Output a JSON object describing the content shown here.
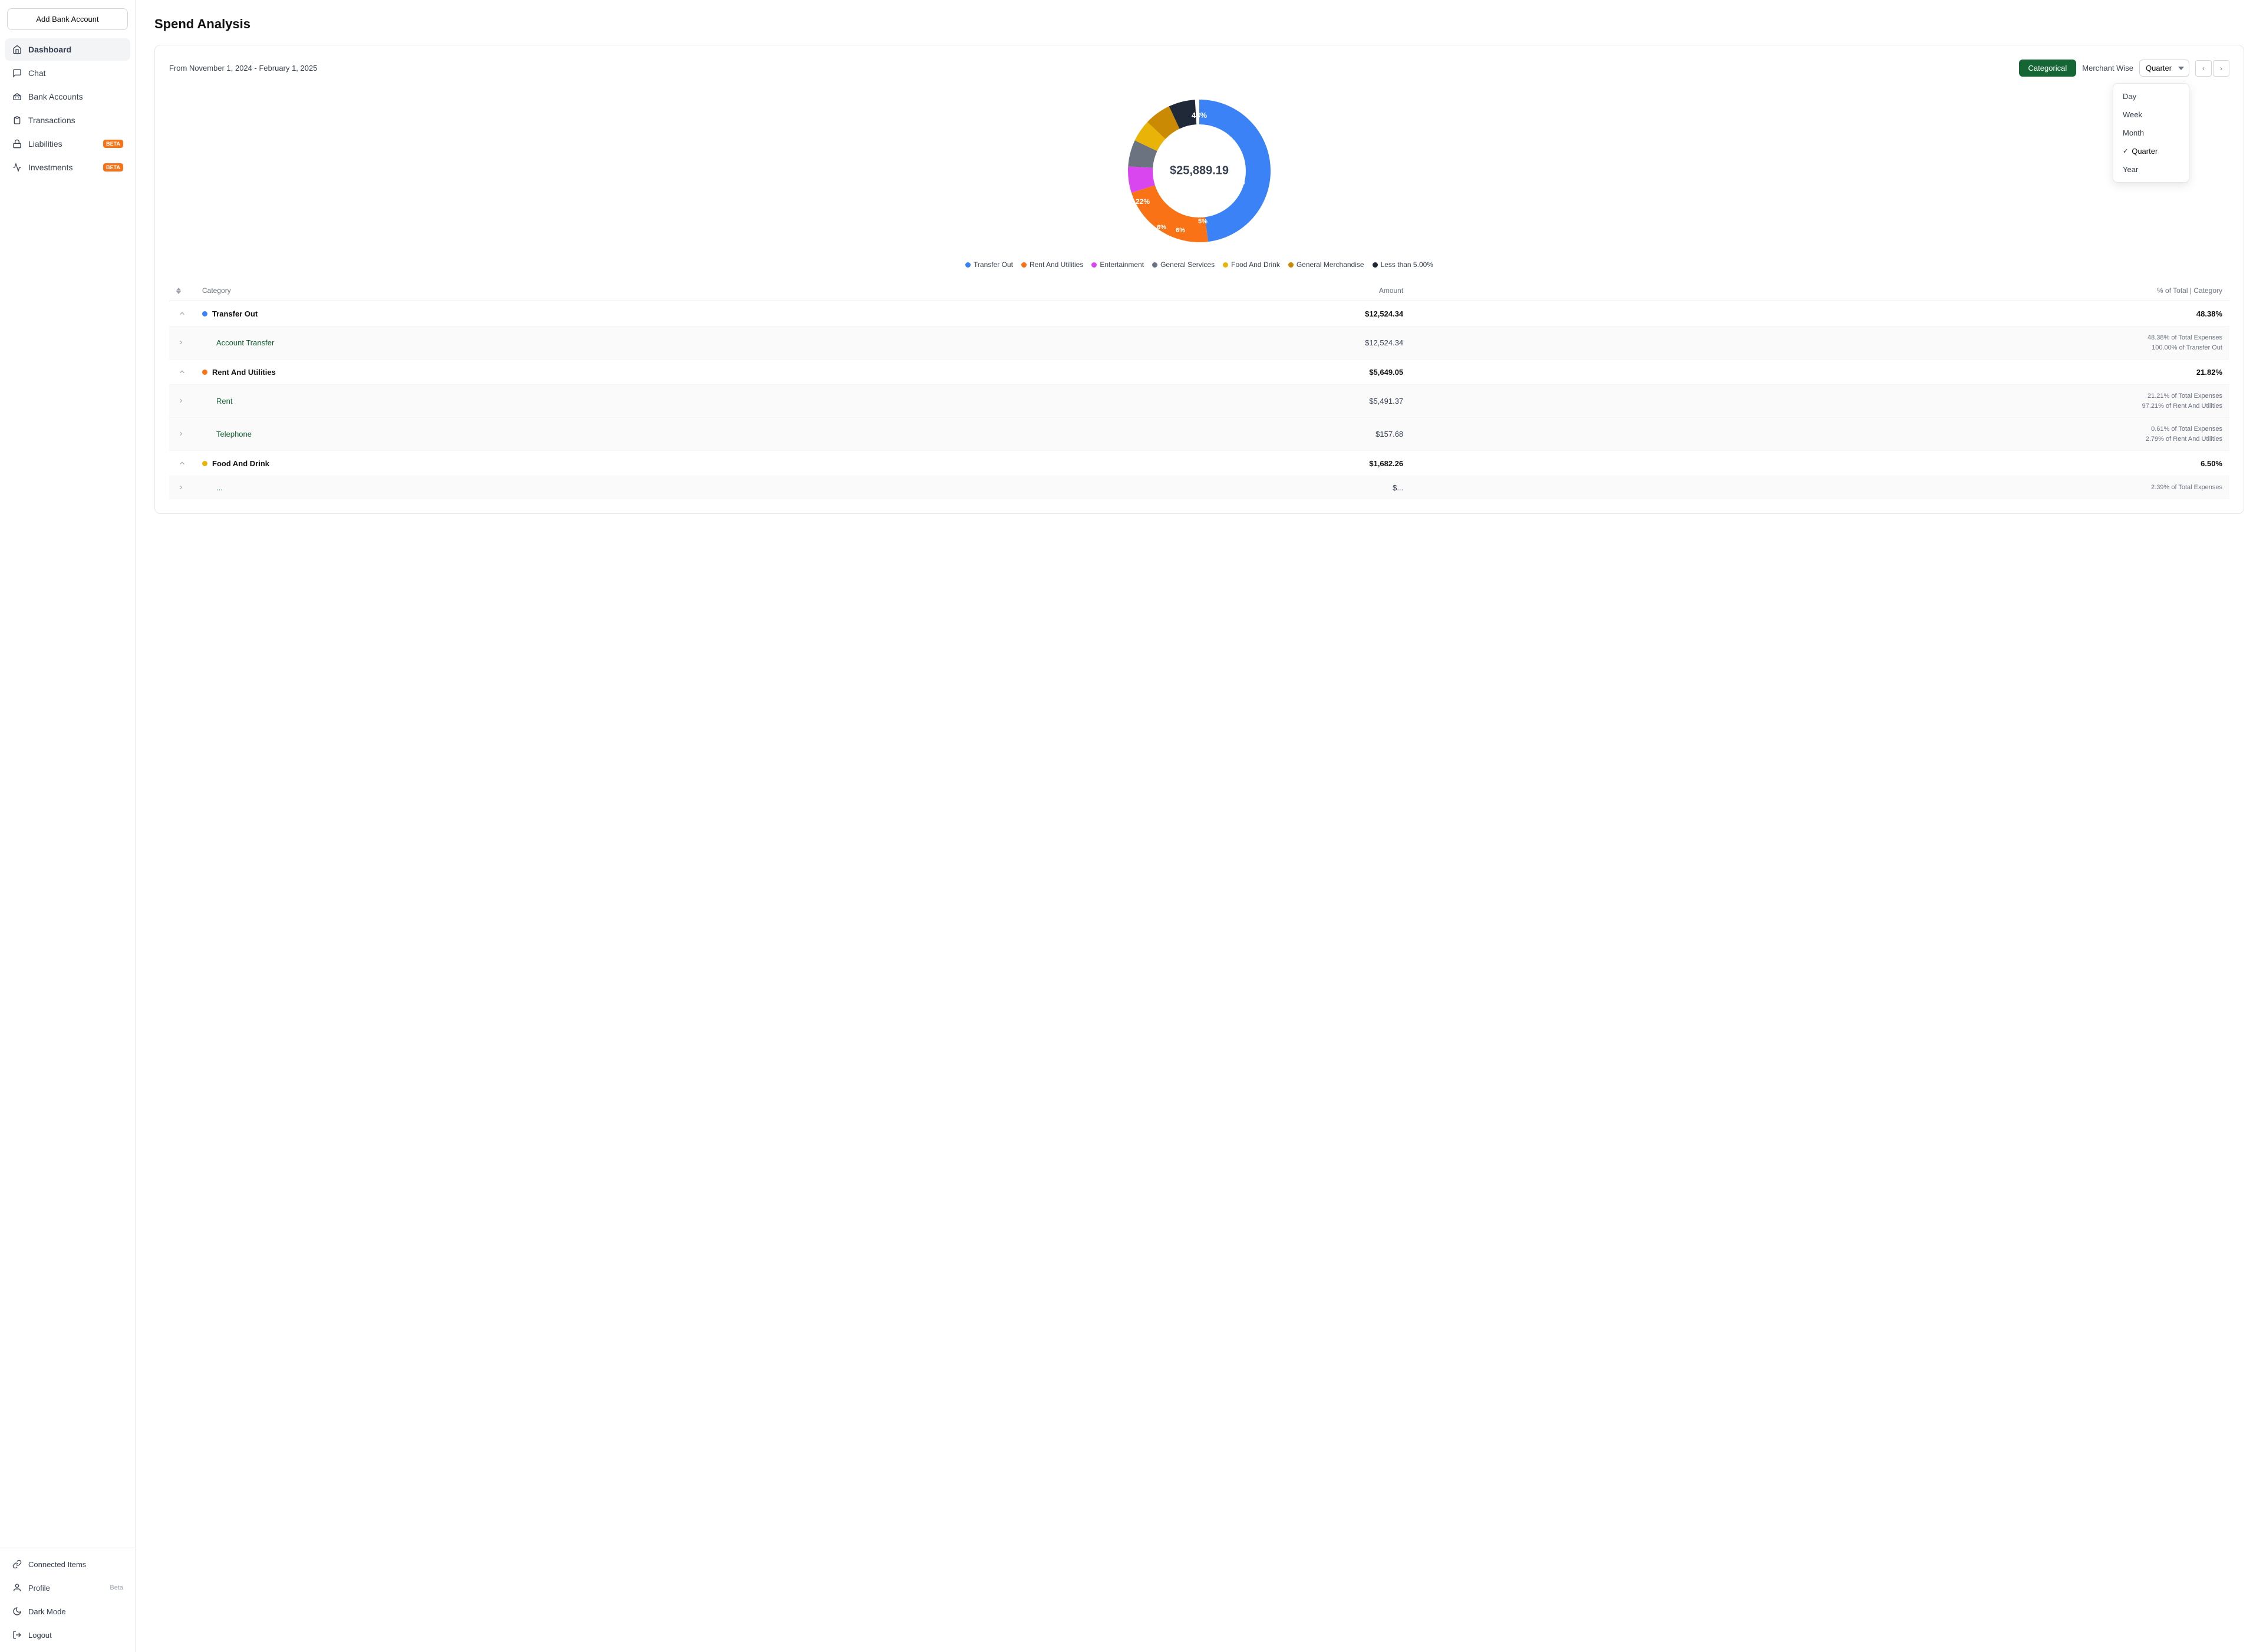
{
  "sidebar": {
    "add_bank_label": "Add Bank Account",
    "nav_items": [
      {
        "id": "dashboard",
        "label": "Dashboard",
        "icon": "house",
        "active": true,
        "badge": null
      },
      {
        "id": "chat",
        "label": "Chat",
        "icon": "chat",
        "active": false,
        "badge": null
      },
      {
        "id": "bank-accounts",
        "label": "Bank Accounts",
        "icon": "bank",
        "active": false,
        "badge": null
      },
      {
        "id": "transactions",
        "label": "Transactions",
        "icon": "receipt",
        "active": false,
        "badge": null
      },
      {
        "id": "liabilities",
        "label": "Liabilities",
        "icon": "lock",
        "active": false,
        "badge": "BETA"
      },
      {
        "id": "investments",
        "label": "Investments",
        "icon": "chart",
        "active": false,
        "badge": "BETA"
      }
    ],
    "bottom_items": [
      {
        "id": "connected-items",
        "label": "Connected Items",
        "icon": "link"
      },
      {
        "id": "profile",
        "label": "Profile",
        "icon": "person",
        "badge_text": "Beta"
      },
      {
        "id": "dark-mode",
        "label": "Dark Mode",
        "icon": "moon"
      },
      {
        "id": "logout",
        "label": "Logout",
        "icon": "door"
      }
    ]
  },
  "main": {
    "page_title": "Spend Analysis",
    "date_range": "From November 1, 2024 - February 1, 2025",
    "view_buttons": {
      "categorical": "Categorical",
      "merchant_wise": "Merchant Wise"
    },
    "time_selector": {
      "current": "Quarter",
      "options": [
        "Day",
        "Week",
        "Month",
        "Quarter",
        "Year"
      ]
    },
    "chart": {
      "center_value": "$25,889.19",
      "segments": [
        {
          "label": "Transfer Out",
          "color": "#3b82f6",
          "pct": 48,
          "start_angle": 0
        },
        {
          "label": "Rent And Utilities",
          "color": "#f97316",
          "pct": 22,
          "start_angle": 173
        },
        {
          "label": "Entertainment",
          "color": "#d946ef",
          "pct": 6,
          "start_angle": 252
        },
        {
          "label": "General Services",
          "color": "#6b7280",
          "pct": 6,
          "start_angle": 274
        },
        {
          "label": "Food And Drink",
          "color": "#eab308",
          "pct": 5,
          "start_angle": 296
        },
        {
          "label": "General Merchandise",
          "color": "#ca8a04",
          "pct": 6,
          "start_angle": 314
        },
        {
          "label": "Less than 5.00%",
          "color": "#1f2937",
          "pct": 6,
          "start_angle": 336
        }
      ]
    },
    "legend": [
      {
        "label": "Transfer Out",
        "color": "#3b82f6"
      },
      {
        "label": "Rent And Utilities",
        "color": "#f97316"
      },
      {
        "label": "Entertainment",
        "color": "#d946ef"
      },
      {
        "label": "General Services",
        "color": "#6b7280"
      },
      {
        "label": "Food And Drink",
        "color": "#eab308"
      },
      {
        "label": "General Merchandise",
        "color": "#ca8a04"
      },
      {
        "label": "Less than 5.00%",
        "color": "#1f2937"
      }
    ],
    "table": {
      "headers": {
        "col1_sort": "",
        "col2": "Category",
        "col3": "Amount",
        "col4": "% of Total | Category"
      },
      "rows": [
        {
          "type": "parent",
          "expanded": true,
          "dot_color": "#3b82f6",
          "category": "Transfer Out",
          "amount": "$12,524.34",
          "pct_main": "48.38%",
          "pct_sub": ""
        },
        {
          "type": "child",
          "category": "Account Transfer",
          "amount": "$12,524.34",
          "pct_main": "",
          "pct_line1": "48.38% of Total Expenses",
          "pct_line2": "100.00% of Transfer Out"
        },
        {
          "type": "parent",
          "expanded": true,
          "dot_color": "#f97316",
          "category": "Rent And Utilities",
          "amount": "$5,649.05",
          "pct_main": "21.82%",
          "pct_sub": ""
        },
        {
          "type": "child",
          "category": "Rent",
          "amount": "$5,491.37",
          "pct_main": "",
          "pct_line1": "21.21% of Total Expenses",
          "pct_line2": "97.21% of Rent And Utilities"
        },
        {
          "type": "child",
          "category": "Telephone",
          "amount": "$157.68",
          "pct_main": "",
          "pct_line1": "0.61% of Total Expenses",
          "pct_line2": "2.79% of Rent And Utilities"
        },
        {
          "type": "parent",
          "expanded": true,
          "dot_color": "#eab308",
          "category": "Food And Drink",
          "amount": "$1,682.26",
          "pct_main": "6.50%",
          "pct_sub": ""
        },
        {
          "type": "child",
          "category": "...",
          "amount": "$...",
          "pct_main": "",
          "pct_line1": "2.39% of Total Expenses",
          "pct_line2": ""
        }
      ]
    }
  }
}
